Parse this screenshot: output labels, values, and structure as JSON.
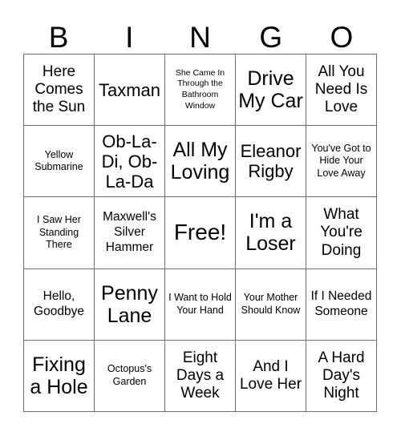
{
  "card": {
    "title_letters": [
      "B",
      "I",
      "N",
      "G",
      "O"
    ],
    "free_space_label": "Free!",
    "colors": {
      "background": "#ffffff",
      "text": "#000000",
      "grid_line": "#6e6e6e"
    },
    "grid": {
      "columns": 5,
      "rows": 5,
      "cells": [
        {
          "text": "Here Comes the Sun",
          "size": "l"
        },
        {
          "text": "Taxman",
          "size": "xl"
        },
        {
          "text": "She Came In Through the Bathroom Window",
          "size": "xs"
        },
        {
          "text": "Drive My Car",
          "size": "xxl"
        },
        {
          "text": "All You Need Is Love",
          "size": "l"
        },
        {
          "text": "Yellow Submarine",
          "size": "s"
        },
        {
          "text": "Ob-La-Di, Ob-La-Da",
          "size": "xl"
        },
        {
          "text": "All My Loving",
          "size": "xxl"
        },
        {
          "text": "Eleanor Rigby",
          "size": "xl"
        },
        {
          "text": "You've Got to Hide Your Love Away",
          "size": "s"
        },
        {
          "text": "I Saw Her Standing There",
          "size": "s"
        },
        {
          "text": "Maxwell's Silver Hammer",
          "size": "m"
        },
        {
          "text": "Free!",
          "size": "free"
        },
        {
          "text": "I'm a Loser",
          "size": "xxl"
        },
        {
          "text": "What You're Doing",
          "size": "l"
        },
        {
          "text": "Hello, Goodbye",
          "size": "m"
        },
        {
          "text": "Penny Lane",
          "size": "xxl"
        },
        {
          "text": "I Want to Hold Your Hand",
          "size": "s"
        },
        {
          "text": "Your Mother Should Know",
          "size": "s"
        },
        {
          "text": "If I Needed Someone",
          "size": "m"
        },
        {
          "text": "Fixing a Hole",
          "size": "xxl"
        },
        {
          "text": "Octopus's Garden",
          "size": "s"
        },
        {
          "text": "Eight Days a Week",
          "size": "l"
        },
        {
          "text": "And I Love Her",
          "size": "l"
        },
        {
          "text": "A Hard Day's Night",
          "size": "l"
        }
      ]
    }
  }
}
